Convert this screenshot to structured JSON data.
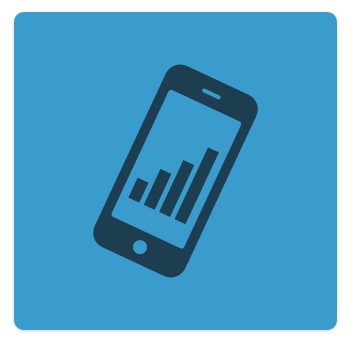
{
  "tile": {
    "icon": "mobile-analytics-icon",
    "background_color": "#3a9ccc",
    "icon_color": "#1d3d50",
    "screen_color": "#3a9ccc"
  },
  "chart": {
    "bar_values": [
      0.25,
      0.45,
      0.65,
      0.9
    ]
  }
}
